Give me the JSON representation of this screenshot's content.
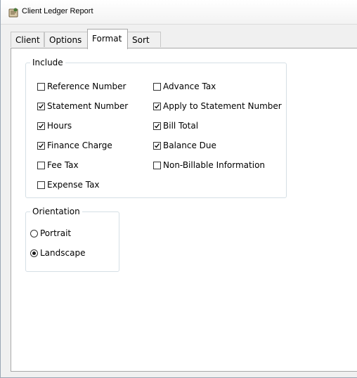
{
  "window": {
    "title": "Client Ledger Report",
    "icon": "ledger-app-icon"
  },
  "tabs": [
    {
      "label": "Client",
      "active": false
    },
    {
      "label": "Options",
      "active": false
    },
    {
      "label": "Format",
      "active": true
    },
    {
      "label": "Sort",
      "active": false
    }
  ],
  "include": {
    "legend": "Include",
    "left": [
      {
        "label": "Reference Number",
        "checked": false
      },
      {
        "label": "Statement Number",
        "checked": true
      },
      {
        "label": "Hours",
        "checked": true
      },
      {
        "label": "Finance Charge",
        "checked": true
      },
      {
        "label": "Fee Tax",
        "checked": false
      },
      {
        "label": "Expense Tax",
        "checked": false
      }
    ],
    "right": [
      {
        "label": "Advance Tax",
        "checked": false
      },
      {
        "label": "Apply to Statement Number",
        "checked": true
      },
      {
        "label": "Bill Total",
        "checked": true
      },
      {
        "label": "Balance Due",
        "checked": true
      },
      {
        "label": "Non-Billable Information",
        "checked": false
      }
    ]
  },
  "orientation": {
    "legend": "Orientation",
    "options": [
      {
        "label": "Portrait",
        "selected": false
      },
      {
        "label": "Landscape",
        "selected": true
      }
    ]
  }
}
